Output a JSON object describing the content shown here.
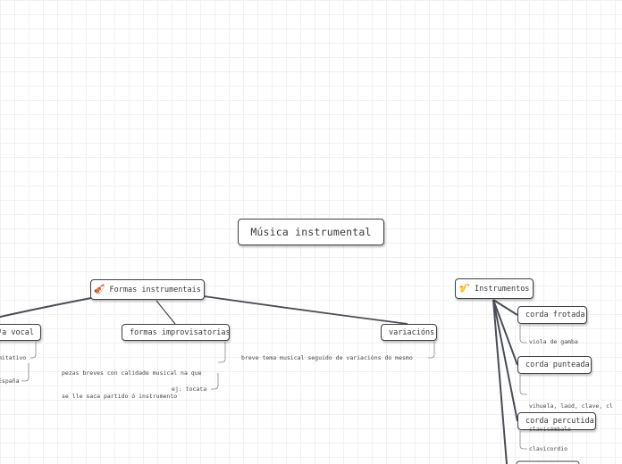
{
  "map": {
    "root": "Música instrumental",
    "nodes": {
      "formas": {
        "label": "Formas instrumentais",
        "icon": "violin-icon",
        "glyph": "🎻"
      },
      "instrumentos": {
        "label": "Instrumentos",
        "icon": "saxophone-icon",
        "glyph": "🎷"
      },
      "vocal": {
        "label": "ºa vocal"
      },
      "improvisatorias": {
        "label": "formas improvisatorias"
      },
      "variacions": {
        "label": "variacións"
      },
      "corda_frotada": {
        "label": "corda frotada"
      },
      "corda_punteada": {
        "label": "corda punteada"
      },
      "corda_percutida": {
        "label": "corda percutida"
      }
    },
    "notes": {
      "imitativo": "mitativo",
      "espana": "España",
      "pezas_line1": "pezas breves con calidade musical na que",
      "pezas_line2": "se lle saca partido ó instrumento",
      "tocata": "ej: tocata",
      "breve": "breve tema musical seguido de variacións do mesmo",
      "viola": "viola de gamba",
      "vihuela_line1": "vihuela, laúd, clave, cl",
      "vihuela_line2": "clavicémbalo",
      "clavicordio": "clavicordio"
    }
  },
  "colors": {
    "branch_line": "#4a4e55",
    "node_border": "#3e4148",
    "grid": "#f1f1f1",
    "text": "#3a3a3a"
  }
}
